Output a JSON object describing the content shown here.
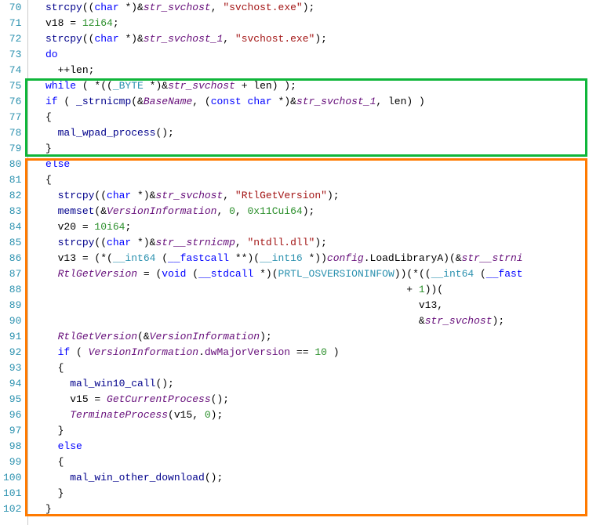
{
  "gutter": {
    "l70": "70",
    "l71": "71",
    "l72": "72",
    "l73": "73",
    "l74": "74",
    "l75": "75",
    "l76": "76",
    "l77": "77",
    "l78": "78",
    "l79": "79",
    "l80": "80",
    "l81": "81",
    "l82": "82",
    "l83": "83",
    "l84": "84",
    "l85": "85",
    "l86": "86",
    "l87": "87",
    "l88": "88",
    "l89": "89",
    "l90": "90",
    "l91": "91",
    "l92": "92",
    "l93": "93",
    "l94": "94",
    "l95": "95",
    "l96": "96",
    "l97": "97",
    "l98": "98",
    "l99": "99",
    "l100": "100",
    "l101": "101",
    "l102": "102"
  },
  "code": {
    "l70": {
      "a": "  strcpy",
      "b": "((",
      "c": "char",
      "d": " *)&",
      "e": "str_svchost",
      "f": ", ",
      "g": "\"svchost.exe\"",
      "h": ");"
    },
    "l71": {
      "a": "  v18 = ",
      "b": "12i64",
      "c": ";"
    },
    "l72": {
      "a": "  strcpy",
      "b": "((",
      "c": "char",
      "d": " *)&",
      "e": "str_svchost_1",
      "f": ", ",
      "g": "\"svchost.exe\"",
      "h": ");"
    },
    "l73": {
      "a": "  do"
    },
    "l74": {
      "a": "    ++len;"
    },
    "l75": {
      "a": "  while",
      "b": " ( *((",
      "c": "_BYTE",
      "d": " *)&",
      "e": "str_svchost",
      "f": " + len) );"
    },
    "l76": {
      "a": "  if",
      "b": " ( ",
      "c": "_strnicmp",
      "d": "(&",
      "e": "BaseName",
      "f": ", (",
      "g": "const",
      "h": " ",
      "i": "char",
      "j": " *)&",
      "k": "str_svchost_1",
      "l": ", len) )"
    },
    "l77": {
      "a": "  {"
    },
    "l78": {
      "a": "    ",
      "b": "mal_wpad_process",
      "c": "();"
    },
    "l79": {
      "a": "  }"
    },
    "l80": {
      "a": "  else"
    },
    "l81": {
      "a": "  {"
    },
    "l82": {
      "a": "    strcpy",
      "b": "((",
      "c": "char",
      "d": " *)&",
      "e": "str_svchost",
      "f": ", ",
      "g": "\"RtlGetVersion\"",
      "h": ");"
    },
    "l83": {
      "a": "    memset",
      "b": "(&",
      "c": "VersionInformation",
      "d": ", ",
      "e": "0",
      "f": ", ",
      "g": "0x11Cui64",
      "h": ");"
    },
    "l84": {
      "a": "    v20 = ",
      "b": "10i64",
      "c": ";"
    },
    "l85": {
      "a": "    strcpy",
      "b": "((",
      "c": "char",
      "d": " *)&",
      "e": "str__strnicmp",
      "f": ", ",
      "g": "\"ntdll.dll\"",
      "h": ");"
    },
    "l86": {
      "a": "    v13 = (*(",
      "b": "__int64",
      "c": " (",
      "d": "__fastcall",
      "e": " **)(",
      "f": "__int16",
      "g": " *))",
      "h": "config",
      "i": ".LoadLibraryA",
      "j": ")(&",
      "k": "str__strni",
      "l": ""
    },
    "l87": {
      "a": "    ",
      "b": "RtlGetVersion",
      "c": " = (",
      "d": "void",
      "e": " (",
      "f": "__stdcall",
      "g": " *)(",
      "h": "PRTL_OSVERSIONINFOW",
      "i": "))(*((",
      "j": "__int64",
      "k": " (",
      "l": "__fast"
    },
    "l88": {
      "a": "                                                             + ",
      "b": "1",
      "c": "))("
    },
    "l89": {
      "a": "                                                               v13,"
    },
    "l90": {
      "a": "                                                               &",
      "b": "str_svchost",
      "c": ");"
    },
    "l91": {
      "a": "    ",
      "b": "RtlGetVersion",
      "c": "(&",
      "d": "VersionInformation",
      "e": ");"
    },
    "l92": {
      "a": "    if",
      "b": " ( ",
      "c": "VersionInformation",
      "d": ".",
      "e": "dwMajorVersion",
      "f": " == ",
      "g": "10",
      "h": " )"
    },
    "l93": {
      "a": "    {"
    },
    "l94": {
      "a": "      ",
      "b": "mal_win10_call",
      "c": "();"
    },
    "l95": {
      "a": "      v15 = ",
      "b": "GetCurrentProcess",
      "c": "();"
    },
    "l96": {
      "a": "      ",
      "b": "TerminateProcess",
      "c": "(v15, ",
      "d": "0",
      "e": ");"
    },
    "l97": {
      "a": "    }"
    },
    "l98": {
      "a": "    else"
    },
    "l99": {
      "a": "    {"
    },
    "l100": {
      "a": "      ",
      "b": "mal_win_other_download",
      "c": "();"
    },
    "l101": {
      "a": "    }"
    },
    "l102": {
      "a": "  }"
    }
  }
}
